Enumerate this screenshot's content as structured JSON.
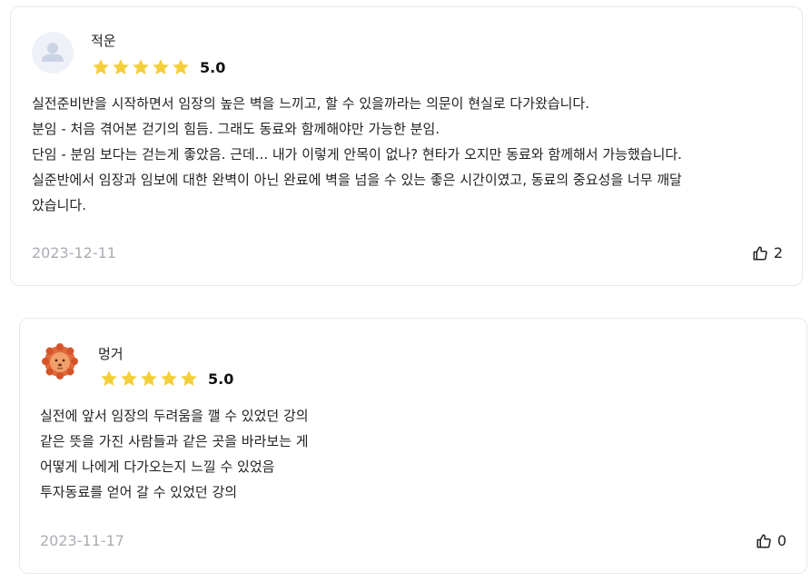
{
  "colors": {
    "star": "#F5CF3A",
    "date": "#a9adb3",
    "border": "#e6e8eb"
  },
  "reviews": [
    {
      "author": "적운",
      "avatar": "default-user-icon",
      "rating": 5,
      "score": "5.0",
      "lines": [
        "실전준비반을 시작하면서 임장의 높은 벽을 느끼고, 할 수 있을까라는 의문이 현실로 다가왔습니다.",
        "분임 - 처음 겪어본 걷기의 힘듬. 그래도 동료와 함께해야만 가능한 분임.",
        "단임 - 분임 보다는 걷는게 좋았음. 근데... 내가 이렇게 안목이 없나? 현타가 오지만 동료와 함께해서 가능했습니다.",
        "실준반에서 임장과 임보에 대한 완벽이 아닌 완료에 벽을 넘을 수 있는 좋은 시간이였고, 동료의 중요성을 너무 깨달",
        "았습니다."
      ],
      "date": "2023-12-11",
      "likes": "2"
    },
    {
      "author": "멍거",
      "avatar": "lion-avatar-icon",
      "rating": 5,
      "score": "5.0",
      "lines": [
        "실전에 앞서 임장의 두려움을 깰 수 있었던 강의",
        "같은 뜻을 가진 사람들과 같은 곳을 바라보는 게",
        "어떻게 나에게 다가오는지 느낄 수 있었음",
        "투자동료를 얻어 갈 수 있었던 강의"
      ],
      "date": "2023-11-17",
      "likes": "0"
    }
  ]
}
